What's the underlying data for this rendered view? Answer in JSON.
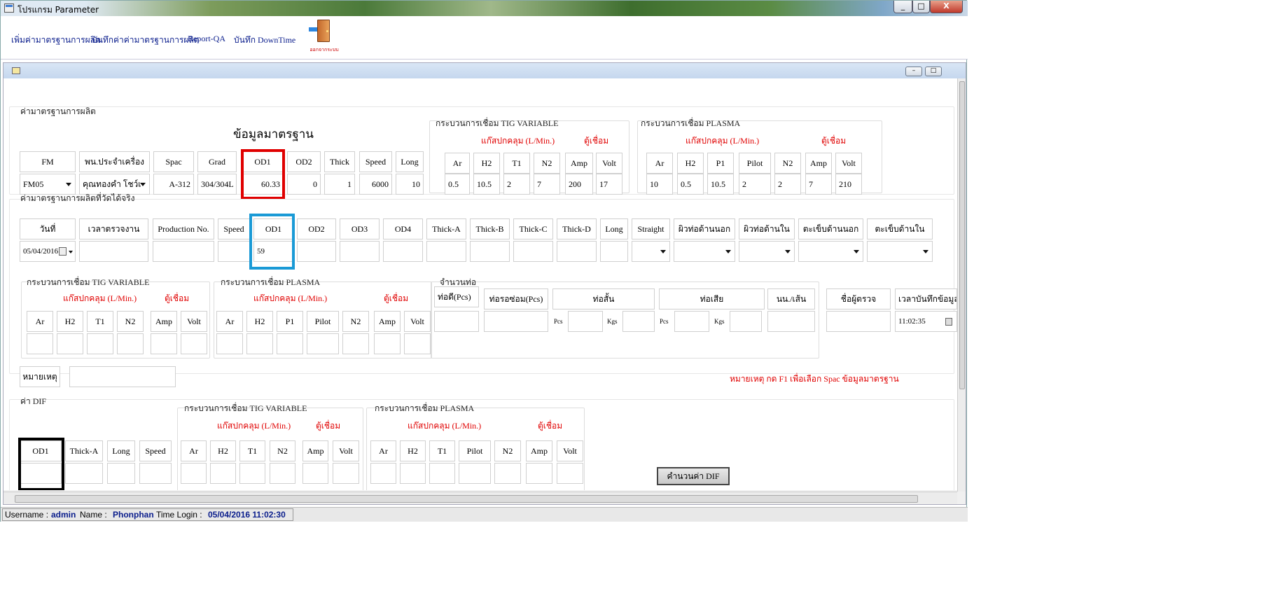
{
  "window": {
    "title": "โปรแกรม Parameter",
    "min": "_",
    "max": "□",
    "close": "X"
  },
  "menu": {
    "items": [
      "เพิ่มค่ามาตรฐานการผลิต",
      "บันทึกค่าค่ามาตรฐานการผลิต",
      "Report-QA",
      "บันทึก DownTime"
    ],
    "exit_label": "ออกจากระบบ"
  },
  "child": {
    "min": "–",
    "max": "□"
  },
  "std": {
    "section": "ค่ามาตรฐานการผลิต",
    "heading": "ข้อมูลมาตรฐาน",
    "headers": [
      "FM",
      "พน.ประจำเครื่อง",
      "Spac",
      "Grad",
      "OD1",
      "OD2",
      "Thick",
      "Speed",
      "Long"
    ],
    "values": [
      "FM05",
      "คุณทองคำ โชว์เ",
      "A-312",
      "304/304L",
      "60.33",
      "0",
      "1",
      "6000",
      "10"
    ]
  },
  "tig1": {
    "title": "กระบวนการเชื่อม TIG VARIABLE",
    "gas": "แก๊สปกคลุม (L/Min.)",
    "welder": "ตู้เชื่อม",
    "headers": [
      "Ar",
      "H2",
      "T1",
      "N2",
      "Amp",
      "Volt"
    ],
    "values": [
      "0.5",
      "10.5",
      "2",
      "7",
      "200",
      "17"
    ]
  },
  "plasma1": {
    "title": "กระบวนการเชื่อม PLASMA",
    "gas": "แก๊สปกคลุม (L/Min.)",
    "welder": "ตู้เชื่อม",
    "headers": [
      "Ar",
      "H2",
      "P1",
      "Pilot",
      "N2",
      "Amp",
      "Volt"
    ],
    "values": [
      "10",
      "0.5",
      "10.5",
      "2",
      "2",
      "7",
      "210"
    ]
  },
  "actual": {
    "section": "ค่ามาตรฐานการผลิตที่วัดได้จริง",
    "headers": [
      "วันที่",
      "เวลาตรวจงาน",
      "Production No.",
      "Speed",
      "OD1",
      "OD2",
      "OD3",
      "OD4",
      "Thick-A",
      "Thick-B",
      "Thick-C",
      "Thick-D",
      "Long",
      "Straight",
      "ผิวท่อด้านนอก",
      "ผิวท่อด้านใน",
      "ตะเข็บด้านนอก",
      "ตะเข็บด้านใน"
    ],
    "date": "05/04/2016",
    "od1": "59"
  },
  "tig2": {
    "title": "กระบวนการเชื่อม TIG VARIABLE",
    "gas": "แก๊สปกคลุม (L/Min.)",
    "welder": "ตู้เชื่อม",
    "headers": [
      "Ar",
      "H2",
      "T1",
      "N2",
      "Amp",
      "Volt"
    ]
  },
  "plasma2": {
    "title": "กระบวนการเชื่อม PLASMA",
    "gas": "แก๊สปกคลุม (L/Min.)",
    "welder": "ตู้เชื่อม",
    "headers": [
      "Ar",
      "H2",
      "P1",
      "Pilot",
      "N2",
      "Amp",
      "Volt"
    ]
  },
  "pipes": {
    "title": "จำนวนท่อ",
    "good": "ท่อดี(Pcs)",
    "repair": "ท่อรอซ่อม(Pcs)",
    "short": "ท่อสั้น",
    "waste": "ท่อเสีย",
    "weight": "นน./เส้น",
    "pcs": "Pcs",
    "kgs": "Kgs"
  },
  "inspector": {
    "label": "ชื่อผู้ตรวจ",
    "time_label": "เวลาบันทึกข้อมูล",
    "time": "11:02:35"
  },
  "note": {
    "label": "หมายเหตุ",
    "hint": "หมายเหตุ กด F1 เพื่อเลือก Spac ข้อมูลมาตรฐาน"
  },
  "dif": {
    "section": "ค่า DIF",
    "headers": [
      "OD1",
      "Thick-A",
      "Long",
      "Speed"
    ],
    "button": "คำนวนค่า DIF"
  },
  "tig3": {
    "title": "กระบวนการเชื่อม TIG VARIABLE",
    "gas": "แก๊สปกคลุม (L/Min.)",
    "welder": "ตู้เชื่อม",
    "headers": [
      "Ar",
      "H2",
      "T1",
      "N2",
      "Amp",
      "Volt"
    ]
  },
  "plasma3": {
    "title": "กระบวนการเชื่อม PLASMA",
    "gas": "แก๊สปกคลุม (L/Min.)",
    "welder": "ตู้เชื่อม",
    "headers": [
      "Ar",
      "H2",
      "T1",
      "Pilot",
      "N2",
      "Amp",
      "Volt"
    ]
  },
  "status": {
    "username_label": "Username :",
    "username": "admin",
    "name_label": "Name :",
    "name": "Phonphan",
    "login_label": "Time Login :",
    "login": "05/04/2016 11:02:30"
  },
  "colors": {
    "red_box": "#e00000",
    "blue_box": "#1a9ad6",
    "black_box": "#000000"
  }
}
